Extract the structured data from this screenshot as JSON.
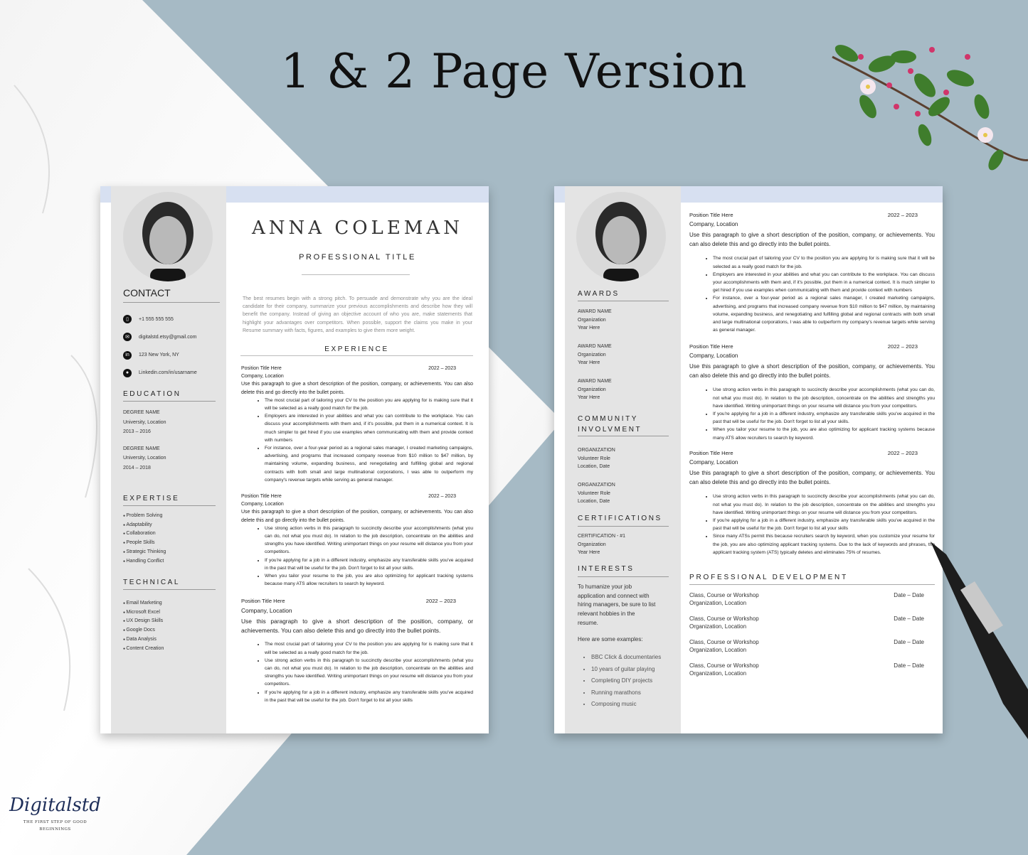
{
  "headline": "1 & 2 Page Version",
  "colors": {
    "background": "#a6bac5",
    "accent_band": "#d7e0f1",
    "sidebar": "#e4e4e4"
  },
  "brand": {
    "logo": "Digitalstd",
    "tagline_1": "THE FIRST STEP OF GOOD",
    "tagline_2": "BEGINNINGS"
  },
  "page1": {
    "name": "ANNA COLEMAN",
    "title": "PROFESSIONAL TITLE",
    "summary": "The best resumes begin with a strong pitch. To persuade and demonstrate why you are the ideal candidate for their company, summarize your previous accomplishments and describe how they will benefit the company. Instead of giving an objective account of who you are, make statements that highlight your advantages over competitors. When possible, support the claims you make in your Resume summary with facts, figures, and examples to give them more weight.",
    "contact_heading": "CONTACT",
    "contact": [
      {
        "icon": "phone-icon",
        "text": "+1 555 555 555"
      },
      {
        "icon": "email-icon",
        "text": "digitalstd.etsy@gmail.com"
      },
      {
        "icon": "linkedin-icon",
        "text": "123 New York, NY"
      },
      {
        "icon": "location-pin-icon",
        "text": "Linkedin.com/in/usarname"
      }
    ],
    "education_heading": "EDUCATION",
    "education": [
      {
        "degree": "DEGREE NAME",
        "school": "University, Location",
        "years": "2013 – 2016"
      },
      {
        "degree": "DEGREE NAME",
        "school": "University, Location",
        "years": "2014 – 2018"
      }
    ],
    "expertise_heading": "EXPERTISE",
    "expertise": [
      "Problem Solving",
      "Adaptability",
      "Collaboration",
      "People Skills",
      "Strategic Thinking",
      "Handling Conflict"
    ],
    "technical_heading": "TECHNICAL",
    "technical": [
      "Email Marketing",
      "Microsoft Excel",
      "UX Design Skills",
      "Google Docs",
      "Data Analysis",
      "Content Creation"
    ],
    "experience_heading": "EXPERIENCE",
    "jobs": [
      {
        "title": "Position Title Here",
        "dates": "2022 – 2023",
        "company": "Company, Location",
        "desc": "Use this paragraph to give a short description of the position, company, or achievements. You can also delete this and go directly into the bullet points.",
        "bullets": [
          "The most crucial part of tailoring your CV to the position you are applying for is making sure that it will be selected as a really good match for the job.",
          "Employers are interested in your abilities and what you can contribute to the workplace. You can discuss your accomplishments with them and, if it's possible, put them in a numerical context. It is much simpler to get hired if you use examples when communicating with them and provide context with numbers",
          "For instance, over a four-year period as a regional sales manager, I created marketing campaigns, advertising, and programs that increased company revenue from $10 million to $47 million, by maintaining volume, expanding business, and renegotiating and fulfilling global and regional contracts with both small and large multinational corporations, I was able to outperform my company's revenue targets while serving as general manager."
        ]
      },
      {
        "title": "Position Title Here",
        "dates": "2022 – 2023",
        "company": "Company, Location",
        "desc": "Use this paragraph to give a short description of the position, company, or achievements. You can also delete this and go directly into the bullet points.",
        "bullets": [
          "Use strong action verbs in this paragraph to succinctly describe your accomplishments (what you can do, not what you must do). In relation to the job description, concentrate on the abilities and strengths you have identified. Writing unimportant things on your resume will distance you from your competitors.",
          "If you're applying for a job in a different industry, emphasize any transferable skills you've acquired in the past that will be useful for the job. Don't forget to list all your skills.",
          "When you tailor your resume to the job, you are also optimizing for applicant tracking systems because many ATS allow recruiters to search by keyword."
        ]
      },
      {
        "title": "Position Title Here",
        "dates": "2022 – 2023",
        "company": "Company, Location",
        "desc": "Use this paragraph to give a short description of the position, company, or achievements. You can also delete this and go directly into the bullet points.",
        "bullets": [
          "The most crucial part of tailoring your CV to the position you are applying for is making sure that it will be selected as a really good match for the job.",
          "Use strong action verbs in this paragraph to succinctly describe your accomplishments (what you can do, not what you must do). In relation to the job description, concentrate on the abilities and strengths you have identified. Writing unimportant things on your resume will distance you from your competitors.",
          "If you're applying for a job in a different industry, emphasize any transferable skills you've acquired in the past that will be useful for the job. Don't forget to list all your skills"
        ]
      }
    ]
  },
  "page2": {
    "awards_heading": "AWARDS",
    "awards": [
      {
        "l1": "AWARD NAME",
        "l2": "Organization",
        "l3": "Year Here"
      },
      {
        "l1": "AWARD NAME",
        "l2": "Organization",
        "l3": "Year Here"
      },
      {
        "l1": "AWARD NAME",
        "l2": "Organization",
        "l3": "Year Here"
      }
    ],
    "community_heading_1": "COMMUNITY",
    "community_heading_2": "INVOLVMENT",
    "community": [
      {
        "l1": "ORGANIZATION",
        "l2": "Volunteer Role",
        "l3": "Location, Date"
      },
      {
        "l1": "ORGANIZATION",
        "l2": "Volunteer Role",
        "l3": "Location, Date"
      }
    ],
    "certifications_heading": "CERTIFICATIONS",
    "certifications": [
      {
        "l1": "CERTIFICATION - #1",
        "l2": "Organization",
        "l3": "Year Here"
      }
    ],
    "interests_heading": "INTERESTS",
    "interests_intro": "To humanize your job application and connect with hiring managers, be sure to list relevant hobbies in the resume.",
    "interests_examples": "Here are some examples:",
    "interests": [
      "BBC Click & documentaries",
      "10 years of guitar playing",
      "Completing DIY projects",
      "Running marathons",
      "Composing music"
    ],
    "jobs": [
      {
        "title": "Position Title Here",
        "dates": "2022 – 2023",
        "company": "Company, Location",
        "desc": "Use this paragraph to give a short description of the position, company, or achievements. You can also delete this and go directly into the bullet points.",
        "bullets": [
          "The most crucial part of tailoring your CV to the position you are applying for is making sure that it will be selected as a really good match for the job.",
          "Employers are interested in your abilities and what you can contribute to the workplace. You can discuss your accomplishments with them and, if it's possible, put them in a numerical context. It is much simpler to get hired if you use examples when communicating with them and provide context with numbers",
          "For instance, over a four-year period as a regional sales manager, I created marketing campaigns, advertising, and programs that increased company revenue from $10 million to $47 million, by maintaining volume, expanding business, and renegotiating and fulfilling global and regional contracts with both small and large multinational corporations, I was able to outperform my company's revenue targets while serving as general manager."
        ]
      },
      {
        "title": "Position Title Here",
        "dates": "2022 – 2023",
        "company": "Company, Location",
        "desc": "Use this paragraph to give a short description of the position, company, or achievements. You can also delete this and go directly into the bullet points.",
        "bullets": [
          "Use strong action verbs in this paragraph to succinctly describe your accomplishments (what you can do, not what you must do). In relation to the job description, concentrate on the abilities and strengths you have identified. Writing unimportant things on your resume will distance you from your competitors.",
          "If you're applying for a job in a different industry, emphasize any transferable skills you've acquired in the past that will be useful for the job. Don't forget to list all your skills.",
          "When you tailor your resume to the job, you are also optimizing for applicant tracking systems because many ATS allow recruiters to search by keyword."
        ]
      },
      {
        "title": "Position Title Here",
        "dates": "2022 – 2023",
        "company": "Company, Location",
        "desc": "Use this paragraph to give a short description of the position, company, or achievements. You can also delete this and go directly into the bullet points.",
        "bullets": [
          "Use strong action verbs in this paragraph to succinctly describe your accomplishments (what you can do, not what you must do). In relation to the job description, concentrate on the abilities and strengths you have identified. Writing unimportant things on your resume will distance you from your competitors.",
          "If you're applying for a job in a different industry, emphasize any transferable skills you've acquired in the past that will be useful for the job. Don't forget to list all your skills",
          "Since many ATSs permit this because recruiters search by keyword, when you customize your resume for the job, you are also optimizing applicant tracking systems. Due to the lack of keywords and phrases, the applicant tracking system (ATS) typically deletes and eliminates 75% of resumes."
        ]
      }
    ],
    "pd_heading": "PROFESSIONAL DEVELOPMENT",
    "pd": [
      {
        "course": "Class, Course or Workshop",
        "org": "Organization, Location",
        "dates": "Date – Date"
      },
      {
        "course": "Class, Course or Workshop",
        "org": "Organization, Location",
        "dates": "Date – Date"
      },
      {
        "course": "Class, Course or Workshop",
        "org": "Organization, Location",
        "dates": "Date – Date"
      },
      {
        "course": "Class, Course or Workshop",
        "org": "Organization, Location",
        "dates": "Date – Date"
      }
    ]
  }
}
